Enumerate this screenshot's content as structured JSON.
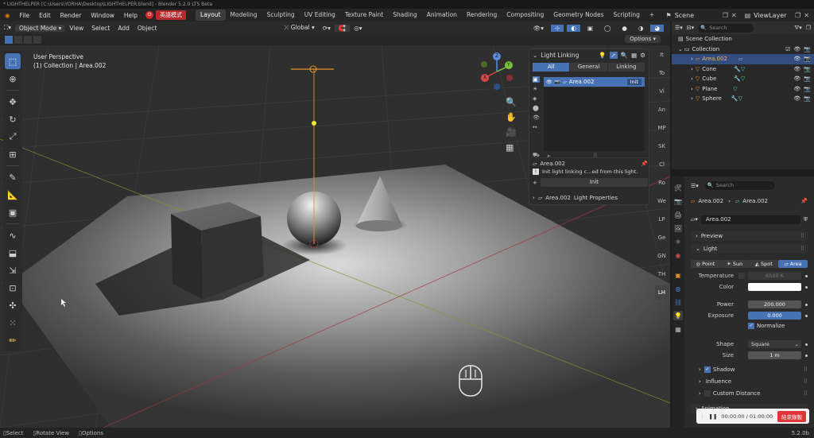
{
  "titlebar": {
    "text": "* LIGHTHELPER [C:\\Users\\YORHA\\Desktop\\LIGHTHELPER.blend] - Blender 5.2.0 LTS Beta"
  },
  "menubar": {
    "menus": [
      "File",
      "Edit",
      "Render",
      "Window",
      "Help"
    ],
    "ime_label": "英語模式",
    "workspaces": [
      "Layout",
      "Modeling",
      "Sculpting",
      "UV Editing",
      "Texture Paint",
      "Shading",
      "Animation",
      "Rendering",
      "Compositing",
      "Geometry Nodes",
      "Scripting"
    ],
    "active_workspace": "Layout",
    "add_tab": "+",
    "scene_label": "Scene",
    "viewlayer_label": "ViewLayer"
  },
  "viewport_header": {
    "mode": "Object Mode",
    "menus": [
      "View",
      "Select",
      "Add",
      "Object"
    ],
    "orientation": "Global",
    "options_label": "Options"
  },
  "viewport": {
    "view_name": "User Perspective",
    "collection_line": "(1) Collection | Area.002",
    "gizmo_axes": [
      "Z",
      "Y",
      "X"
    ]
  },
  "right_strip_tabs": [
    "It",
    "To",
    "Vi",
    "An",
    "MP",
    "SK",
    "Cl",
    "Ro",
    "We",
    "LP",
    "Ge",
    "GN",
    "TH",
    "LH"
  ],
  "light_linking": {
    "title": "Light Linking",
    "filters": [
      "All",
      "General",
      "Linking"
    ],
    "active_filter": "All",
    "item_name": "Area.002",
    "item_button": "Init",
    "selected_name": "Area.002",
    "info_text": "Init light linking c…ed from this light.",
    "init_button": "Init",
    "footer_object": "Area.002",
    "footer_label": "Light Properties"
  },
  "outliner": {
    "search_placeholder": "Search",
    "root": "Scene Collection",
    "collection": "Collection",
    "items": [
      {
        "name": "Area.002",
        "selected": true
      },
      {
        "name": "Cone",
        "selected": false
      },
      {
        "name": "Cube",
        "selected": false
      },
      {
        "name": "Plane",
        "selected": false
      },
      {
        "name": "Sphere",
        "selected": false
      }
    ]
  },
  "properties": {
    "search_placeholder": "Search",
    "breadcrumb_object": "Area.002",
    "breadcrumb_data": "Area.002",
    "datablock_name": "Area.002",
    "sections": {
      "preview": "Preview",
      "light": "Light",
      "shadow": "Shadow",
      "influence": "Influence",
      "custom_distance": "Custom Distance",
      "animation": "Animation"
    },
    "light_types": [
      "Point",
      "Sun",
      "Spot",
      "Area"
    ],
    "active_light_type": "Area",
    "temperature_label": "Temperature",
    "temperature_value": "6500 K",
    "color_label": "Color",
    "power_label": "Power",
    "power_value": "200.000",
    "exposure_label": "Exposure",
    "exposure_value": "0.000",
    "normalize_label": "Normalize",
    "shape_label": "Shape",
    "shape_value": "Square",
    "size_label": "Size",
    "size_value": "1 m"
  },
  "statusbar": {
    "items": [
      "Select",
      "Rotate View",
      "Options"
    ],
    "version": "5.2.0b"
  },
  "recording": {
    "time": "00:00:00 / 01:00:00",
    "stop_label": "結束錄製"
  },
  "colors": {
    "accent": "#4772b3",
    "selected_row": "#334d80",
    "light_orange": "#e6922a"
  }
}
